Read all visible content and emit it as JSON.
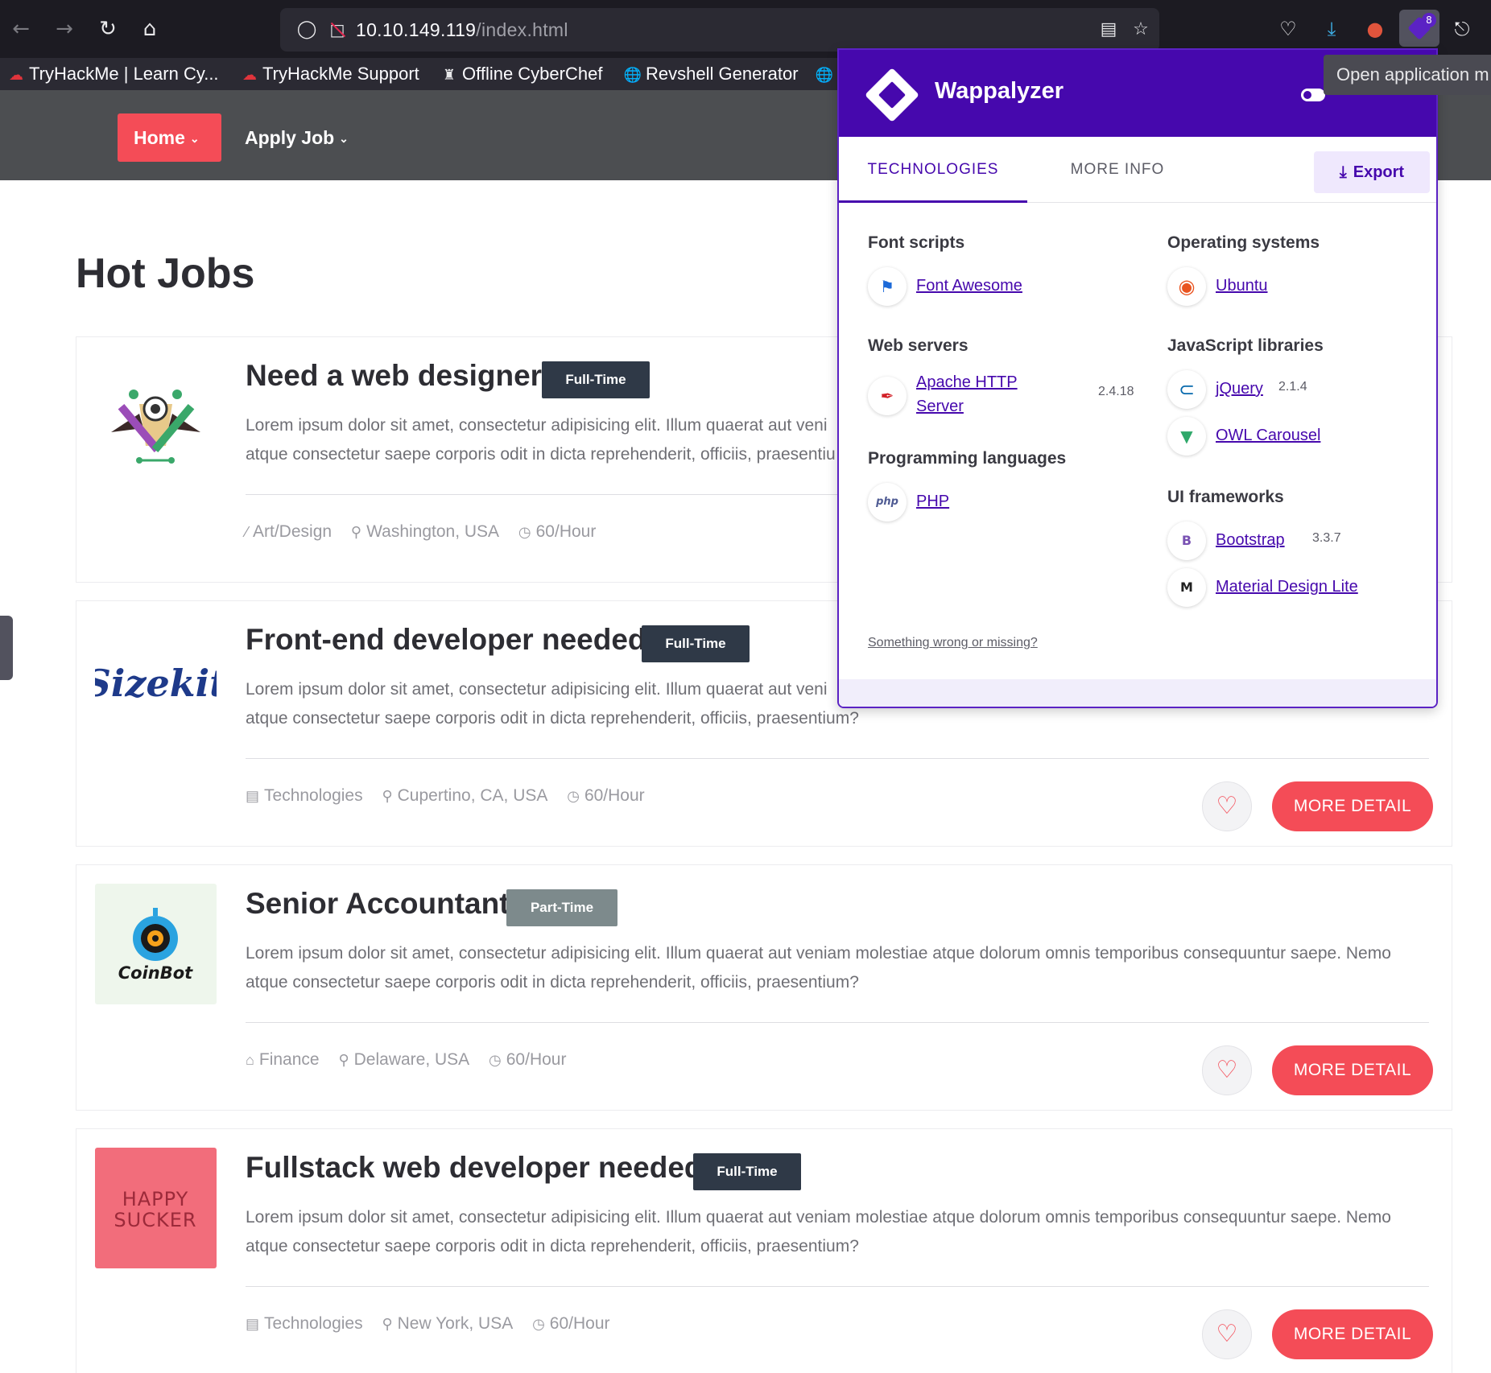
{
  "browser": {
    "url_host": "10.10.149.119",
    "url_path": "/index.html",
    "extension_badge": "8",
    "tooltip": "Open application m"
  },
  "bookmarks": [
    {
      "label": "TryHackMe | Learn Cy...",
      "icon": "tryhackme-cloud-icon"
    },
    {
      "label": "TryHackMe Support",
      "icon": "tryhackme-cloud-icon"
    },
    {
      "label": "Offline CyberChef",
      "icon": "chef-hat-icon"
    },
    {
      "label": "Revshell Generator",
      "icon": "globe-icon"
    }
  ],
  "nav": {
    "home": "Home",
    "apply": "Apply Job"
  },
  "page": {
    "title": "Hot Jobs"
  },
  "jobs": [
    {
      "title": "Need a web designer",
      "type": "Full-Time",
      "desc_line1": "Lorem ipsum dolor sit amet, consectetur adipisicing elit. Illum quaerat aut veni",
      "desc_line2": "atque consectetur saepe corporis odit in dicta reprehenderit, officiis, praesentiu",
      "category": "Art/Design",
      "location": "Washington, USA",
      "rate": "60/Hour"
    },
    {
      "title": "Front-end developer needed",
      "type": "Full-Time",
      "desc_line1": "Lorem ipsum dolor sit amet, consectetur adipisicing elit. Illum quaerat aut veni",
      "desc_line2": "atque consectetur saepe corporis odit in dicta reprehenderit, officiis, praesentium?",
      "category": "Technologies",
      "location": "Cupertino, CA, USA",
      "rate": "60/Hour",
      "logo_text": "Sizekit"
    },
    {
      "title": "Senior Accountant",
      "type": "Part-Time",
      "desc_line1": "Lorem ipsum dolor sit amet, consectetur adipisicing elit. Illum quaerat aut veniam molestiae atque dolorum omnis temporibus consequuntur saepe. Nemo",
      "desc_line2": "atque consectetur saepe corporis odit in dicta reprehenderit, officiis, praesentium?",
      "category": "Finance",
      "location": "Delaware, USA",
      "rate": "60/Hour",
      "logo_text": "CoinBot"
    },
    {
      "title": "Fullstack web developer needed",
      "type": "Full-Time",
      "desc_line1": "Lorem ipsum dolor sit amet, consectetur adipisicing elit. Illum quaerat aut veniam molestiae atque dolorum omnis temporibus consequuntur saepe. Nemo",
      "desc_line2": "atque consectetur saepe corporis odit in dicta reprehenderit, officiis, praesentium?",
      "category": "Technologies",
      "location": "New York, USA",
      "rate": "60/Hour",
      "logo_line1": "HAPPY",
      "logo_line2": "SUCKER"
    }
  ],
  "more_detail": "MORE DETAIL",
  "wappalyzer": {
    "name": "Wappalyzer",
    "tab_technologies": "TECHNOLOGIES",
    "tab_more_info": "MORE INFO",
    "export": "Export",
    "font_scripts": "Font scripts",
    "font_awesome": "Font Awesome",
    "web_servers": "Web servers",
    "apache_line1": "Apache HTTP",
    "apache_line2": "Server",
    "apache_version": "2.4.18",
    "programming_languages": "Programming languages",
    "php": "PHP",
    "php_icon_text": "php",
    "operating_systems": "Operating systems",
    "ubuntu": "Ubuntu",
    "js_libraries": "JavaScript libraries",
    "jquery": "jQuery",
    "jquery_version": "2.1.4",
    "owl": "OWL Carousel",
    "ui_frameworks": "UI frameworks",
    "bootstrap": "Bootstrap",
    "bootstrap_version": "3.3.7",
    "bootstrap_icon_text": "B",
    "mdl": "Material Design Lite",
    "mdl_icon_text": "M",
    "wrong": "Something wrong or missing?"
  },
  "colors": {
    "accent": "#f44c57",
    "wappalyzer_purple": "#4608ad",
    "header_bg": "#4c4e51"
  }
}
